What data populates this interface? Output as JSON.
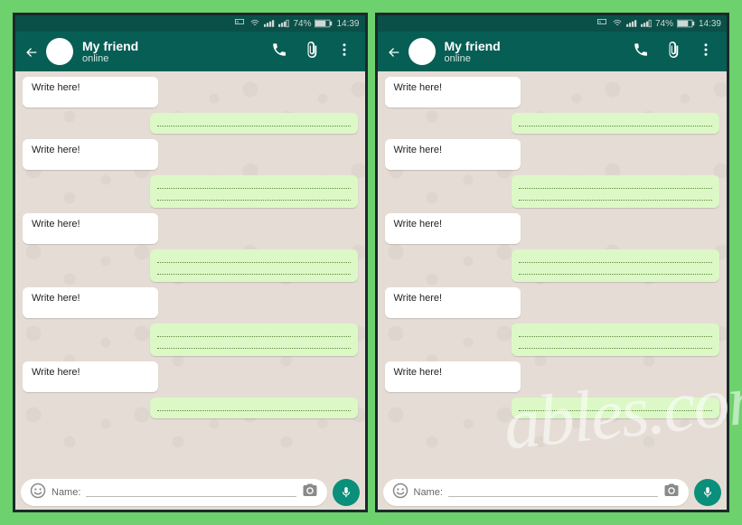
{
  "statusbar": {
    "battery": "74%",
    "time": "14:39",
    "nfc": "NFC"
  },
  "header": {
    "name": "My friend",
    "status": "online"
  },
  "bubbles": {
    "incoming_text": "Write here!"
  },
  "inputbar": {
    "name_label": "Name:"
  },
  "watermark": "ables.com"
}
